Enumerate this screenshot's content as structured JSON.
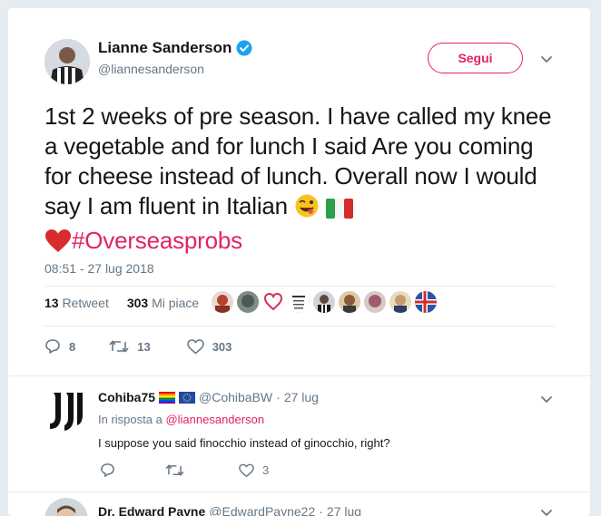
{
  "tweet": {
    "author_name": "Lianne Sanderson",
    "author_handle": "@liannesanderson",
    "follow_label": "Segui",
    "text_before_hashtag": "1st 2 weeks of pre season. I have called my knee a vegetable and for lunch I said Are you coming for cheese instead of lunch. Overall now I would say I am fluent in Italian ",
    "hashtag": "#Overseasprobs",
    "timestamp": "08:51 - 27 lug 2018",
    "retweet_count": "13",
    "retweet_label": "Retweet",
    "like_count": "303",
    "like_label": "Mi piace",
    "reply_action_count": "8",
    "retweet_action_count": "13",
    "like_action_count": "303"
  },
  "replies": [
    {
      "author_name": "Cohiba75",
      "author_handle": "@CohibaBW",
      "date": "27 lug",
      "in_reply_prefix": "In risposta a",
      "in_reply_handle": "@liannesanderson",
      "text": "I suppose you said finocchio instead of ginocchio, right?",
      "like_count": "3"
    },
    {
      "author_name": "Dr. Edward Payne",
      "author_handle": "@EdwardPayne22",
      "date": "27 lug"
    }
  ],
  "colors": {
    "accent": "#e0245e",
    "verified": "#1da1f2",
    "muted": "#657786"
  }
}
